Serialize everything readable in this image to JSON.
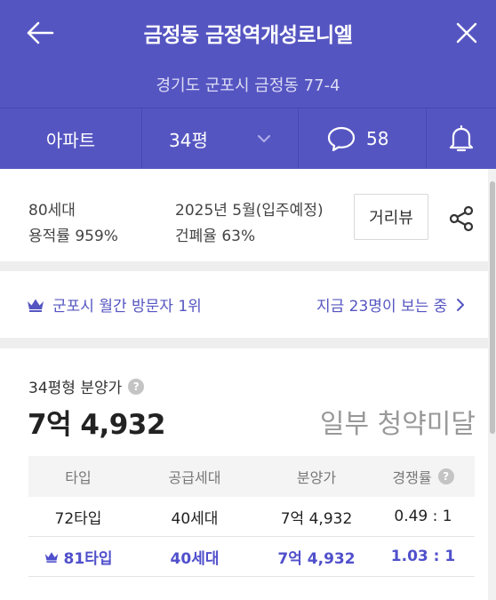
{
  "header": {
    "title": "금정동 금정역개성로니엘",
    "address": "경기도 군포시 금정동 77-4"
  },
  "tabs": {
    "type_label": "아파트",
    "size_label": "34평",
    "comment_count": "58"
  },
  "info": {
    "households": "80세대",
    "floor_area_ratio": "용적률 959%",
    "move_in": "2025년 5월(입주예정)",
    "coverage_ratio": "건폐율 63%",
    "road_view_label": "거리뷰"
  },
  "rank": {
    "text": "군포시 월간 방문자 1위",
    "viewers": "지금 23명이 보는 중"
  },
  "price": {
    "label": "34평형 분양가",
    "value": "7억 4,932",
    "status": "일부 청약미달"
  },
  "table": {
    "headers": [
      "타입",
      "공급세대",
      "분양가",
      "경쟁률"
    ],
    "rows": [
      {
        "type": "72타입",
        "units": "40세대",
        "price": "7억 4,932",
        "ratio": "0.49 : 1"
      },
      {
        "type": "81타입",
        "units": "40세대",
        "price": "7억 4,932",
        "ratio": "1.03 : 1"
      }
    ]
  },
  "colors": {
    "brand": "#5555c2",
    "highlight": "#5050cc"
  }
}
